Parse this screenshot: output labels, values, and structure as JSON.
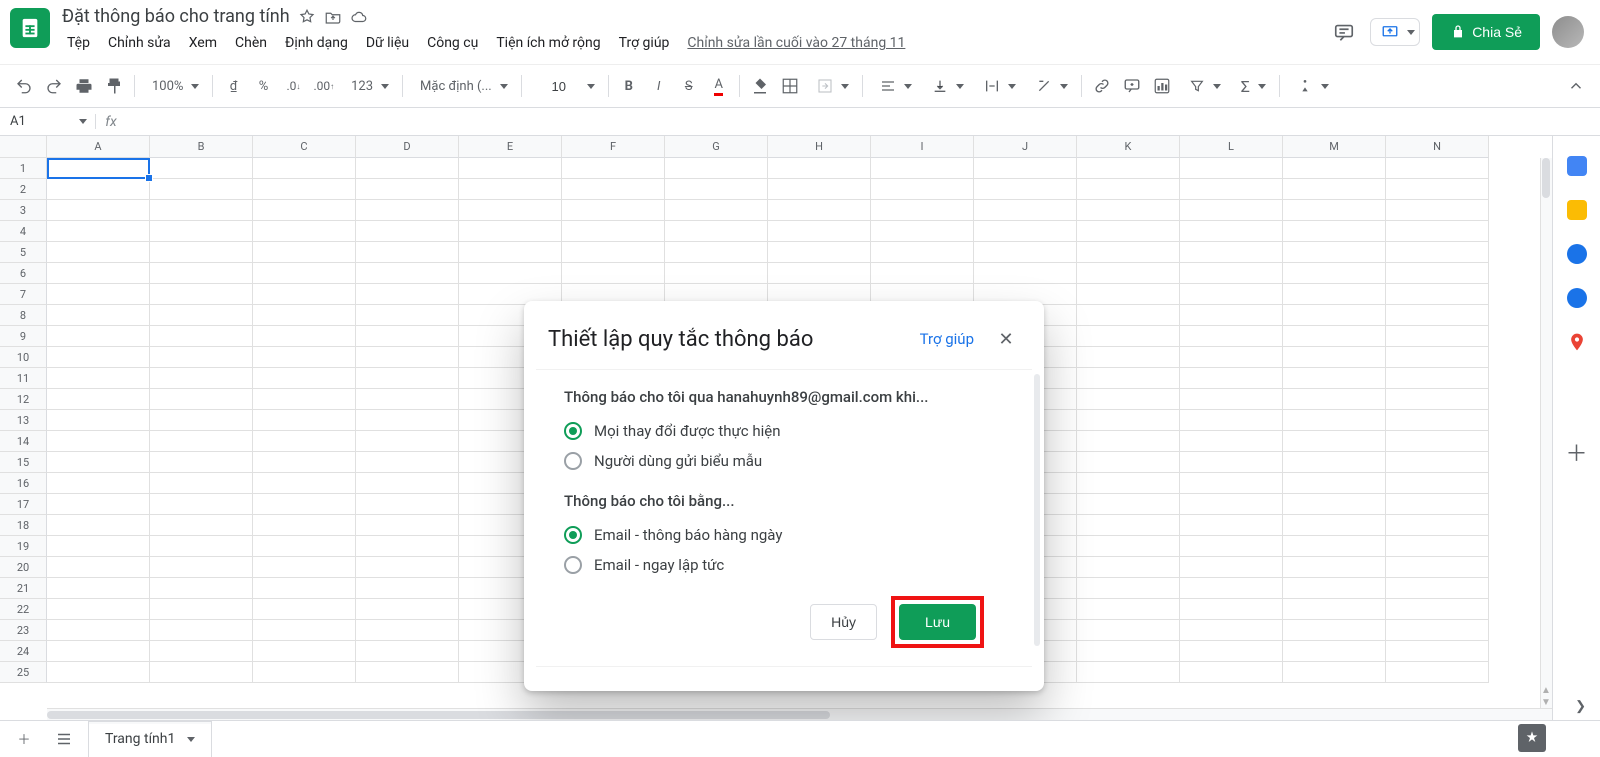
{
  "app": {
    "doc_title": "Đặt thông báo cho trang tính",
    "last_edit": "Chỉnh sửa lần cuối vào 27 tháng 11",
    "share_label": "Chia Sẻ",
    "active_sheet": "Trang tính1"
  },
  "menubar": [
    "Tệp",
    "Chỉnh sửa",
    "Xem",
    "Chèn",
    "Định dạng",
    "Dữ liệu",
    "Công cụ",
    "Tiện ích mở rộng",
    "Trợ giúp"
  ],
  "toolbar": {
    "zoom": "100%",
    "currency": "₫",
    "percent": "%",
    "dec_less": ".0",
    "dec_more": ".00",
    "number_format": "123",
    "font": "Mặc định (...",
    "font_size": "10"
  },
  "formula": {
    "name_box": "A1",
    "fx_label": "fx",
    "value": ""
  },
  "columns": [
    "A",
    "B",
    "C",
    "D",
    "E",
    "F",
    "G",
    "H",
    "I",
    "J",
    "K",
    "L",
    "M",
    "N"
  ],
  "rows_count": 25,
  "dialog": {
    "title": "Thiết lập quy tắc thông báo",
    "help": "Trợ giúp",
    "section1_title": "Thông báo cho tôi qua hanahuynh89@gmail.com khi...",
    "opt_all_changes": "Mọi thay đổi được thực hiện",
    "opt_form_submit": "Người dùng gửi biểu mẫu",
    "section2_title": "Thông báo cho tôi bằng...",
    "opt_daily": "Email - thông báo hàng ngày",
    "opt_instant": "Email - ngay lập tức",
    "cancel": "Hủy",
    "save": "Lưu"
  },
  "side_icons": [
    "calendar",
    "keep",
    "tasks",
    "contacts",
    "maps"
  ]
}
